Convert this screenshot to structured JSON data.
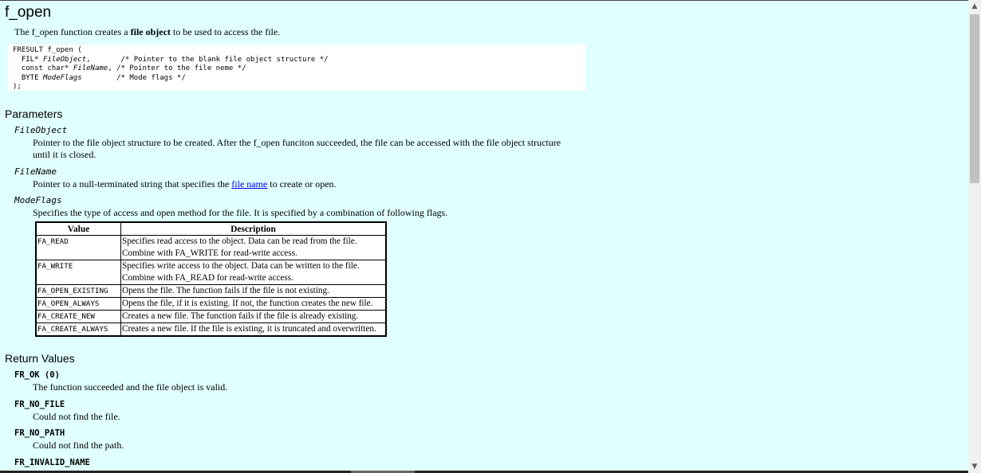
{
  "page": {
    "title": "f_open",
    "intro_before": "The f_open function creates a ",
    "intro_bold": "file object",
    "intro_after": " to be used to access the file."
  },
  "prototype": {
    "line1": "FRESULT f_open (",
    "line2_pre": "  FIL* ",
    "line2_param": "FileObject",
    "line2_post": ",       /* Pointer to the blank file object structure */",
    "line3_pre": "  const char* ",
    "line3_param": "FileName",
    "line3_post": ", /* Pointer to the file neme */",
    "line4_pre": "  BYTE ",
    "line4_param": "ModeFlags",
    "line4_post": "        /* Mode flags */",
    "line5": ");"
  },
  "parameters": {
    "heading": "Parameters",
    "file_object": {
      "name": "FileObject",
      "desc": "Pointer to the file object structure to be created. After the f_open funciton succeeded, the file can be accessed with the file object structure until it is closed."
    },
    "file_name": {
      "name": "FileName",
      "desc_before": "Pointer to a null-terminated string that specifies the ",
      "desc_link": "file name",
      "desc_after": " to create or open."
    },
    "mode_flags": {
      "name": "ModeFlags",
      "desc": "Specifies the type of access and open method for the file. It is specified by a combination of following flags."
    }
  },
  "flags_table": {
    "headers": [
      "Value",
      "Description"
    ],
    "rows": [
      {
        "value": "FA_READ",
        "desc": "Specifies read access to the object. Data can be read from the file. Combine with FA_WRITE for read-write access."
      },
      {
        "value": "FA_WRITE",
        "desc": "Specifies write access to the object. Data can be written to the file. Combine with FA_READ for read-write access."
      },
      {
        "value": "FA_OPEN_EXISTING",
        "desc": "Opens the file. The function fails if the file is not existing."
      },
      {
        "value": "FA_OPEN_ALWAYS",
        "desc": "Opens the file, if it is existing. If not, the function creates the new file."
      },
      {
        "value": "FA_CREATE_NEW",
        "desc": "Creates a new file. The function fails if the file is already existing."
      },
      {
        "value": "FA_CREATE_ALWAYS",
        "desc": "Creates a new file. If the file is existing, it is truncated and overwritten."
      }
    ]
  },
  "return_values": {
    "heading": "Return Values",
    "items": [
      {
        "name": "FR_OK (0)",
        "desc": "The function succeeded and the file object is valid."
      },
      {
        "name": "FR_NO_FILE",
        "desc": "Could not find the file."
      },
      {
        "name": "FR_NO_PATH",
        "desc": "Could not find the path."
      },
      {
        "name": "FR_INVALID_NAME",
        "desc": ""
      }
    ]
  },
  "scrollbar": {
    "up_icon": "chevron-up-icon",
    "down_icon": "chevron-down-icon"
  }
}
